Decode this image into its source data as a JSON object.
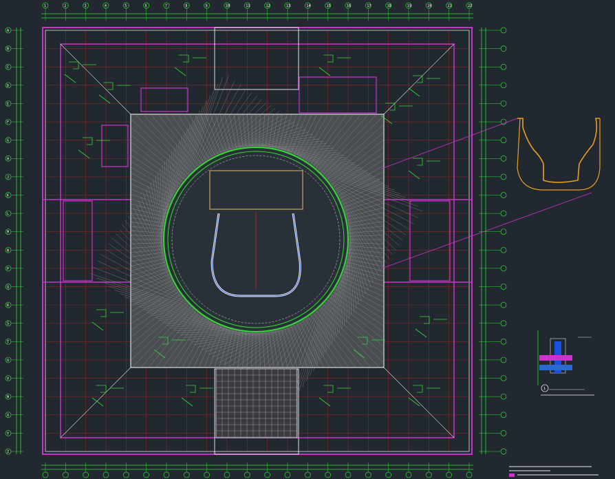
{
  "drawing": {
    "colors": {
      "background": "#212830",
      "grid_red": "#8a2a2a",
      "wall_green": "#33dd33",
      "boundary_magenta": "#cc33cc",
      "hatch_gray": "#9a9a9a",
      "detail_orange": "#e8a020",
      "white_line": "#e0e0e0"
    },
    "grid_columns_top": [
      "1",
      "2",
      "3",
      "4",
      "5",
      "6",
      "7",
      "8",
      "9",
      "10",
      "11",
      "12",
      "13",
      "14",
      "15",
      "16",
      "17",
      "18",
      "19",
      "20",
      "21",
      "22"
    ],
    "grid_rows_left": [
      "A",
      "B",
      "C",
      "D",
      "E",
      "F",
      "G",
      "H",
      "J",
      "K",
      "L",
      "M",
      "N",
      "P",
      "Q",
      "R",
      "S",
      "T",
      "U",
      "V",
      "W",
      "X",
      "Y",
      "Z"
    ],
    "detail_callout_number": "1",
    "notes": []
  }
}
